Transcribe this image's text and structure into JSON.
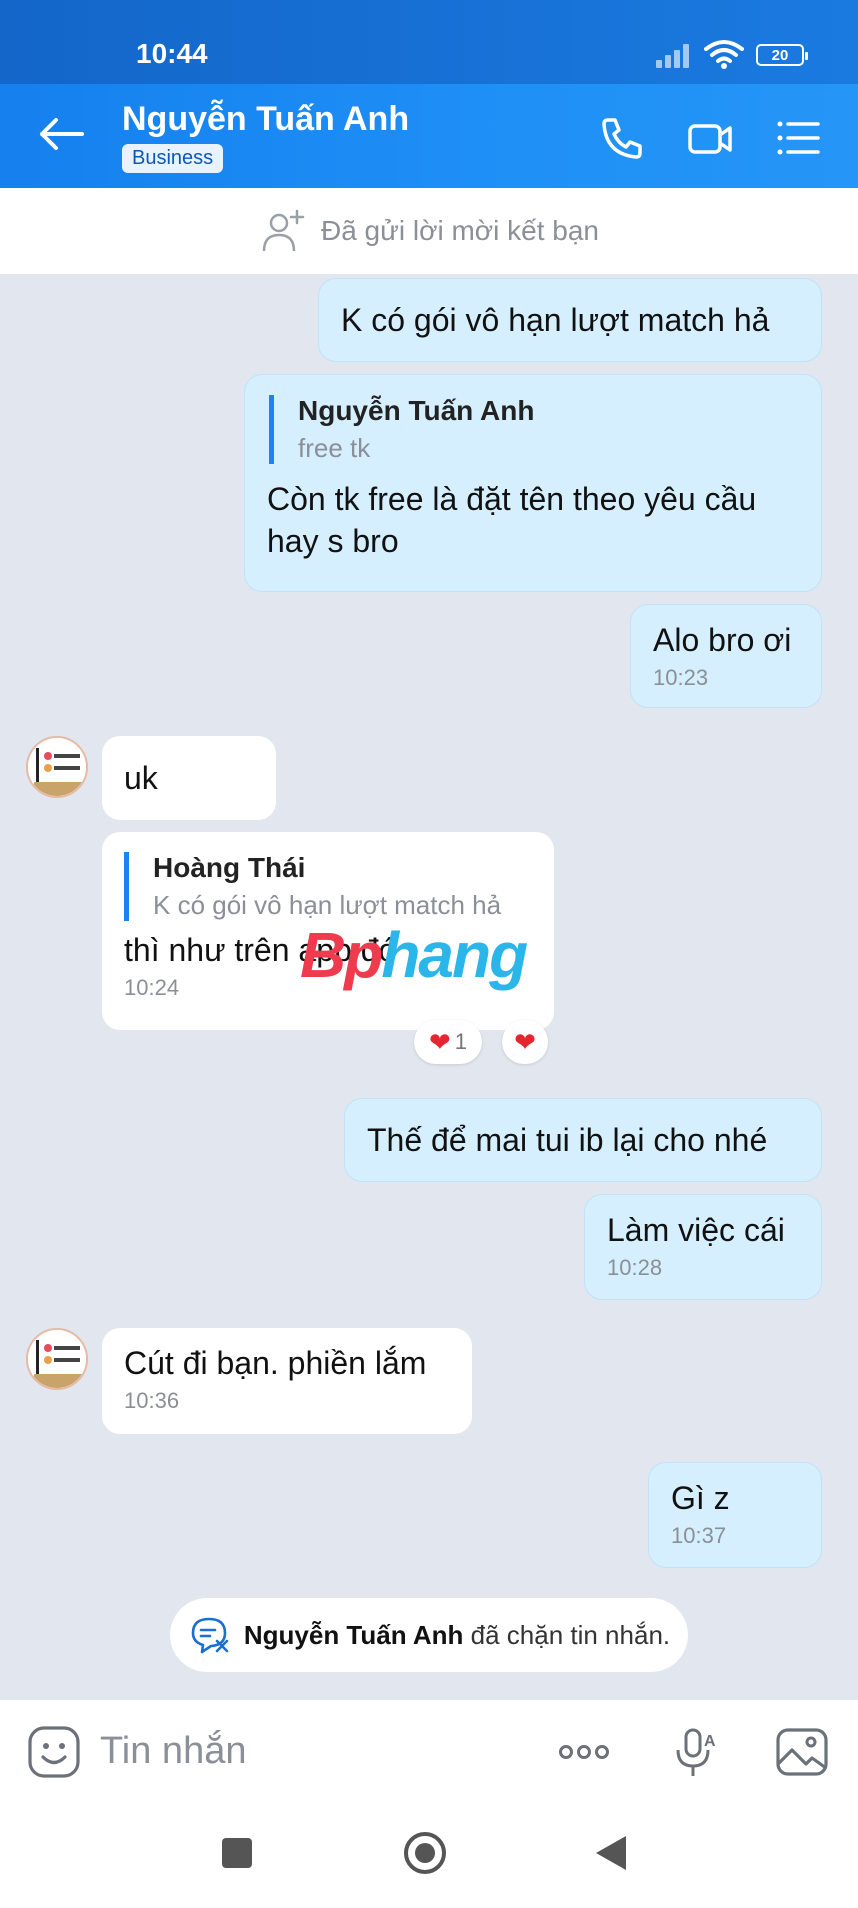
{
  "status": {
    "time": "10:44",
    "battery": "20"
  },
  "header": {
    "name": "Nguyễn Tuấn Anh",
    "badge": "Business"
  },
  "friend_strip": {
    "text": "Đã gửi lời mời kết bạn"
  },
  "messages": {
    "m1": {
      "text": "K có gói vô hạn lượt match hả"
    },
    "m2": {
      "quote_author": "Nguyễn Tuấn Anh",
      "quote_text": "free tk",
      "text": "Còn tk free là đặt tên theo yêu cầu hay s bro"
    },
    "m3": {
      "text": "Alo bro ơi",
      "time": "10:23"
    },
    "m4": {
      "text": "uk"
    },
    "m5": {
      "quote_author": "Hoàng Thái",
      "quote_text": "K có gói vô hạn lượt match hả",
      "text": "thì như trên app đó",
      "time": "10:24",
      "reaction_count": "1"
    },
    "m6": {
      "text": "Thế để mai tui ib lại cho nhé"
    },
    "m7": {
      "text": "Làm việc cái",
      "time": "10:28"
    },
    "m8": {
      "text": "Cút đi bạn. phiền lắm",
      "time": "10:36"
    },
    "m9": {
      "text": "Gì z",
      "time": "10:37"
    }
  },
  "watermark": {
    "part1": "Bp",
    "part2": "hang"
  },
  "blocked": {
    "name": "Nguyễn Tuấn Anh",
    "suffix": " đã chặn tin nhắn."
  },
  "input": {
    "placeholder": "Tin nhắn"
  },
  "colors": {
    "header": "#1e8ff6",
    "outgoing_bubble": "#d5efff",
    "accent": "#1a85f0"
  }
}
